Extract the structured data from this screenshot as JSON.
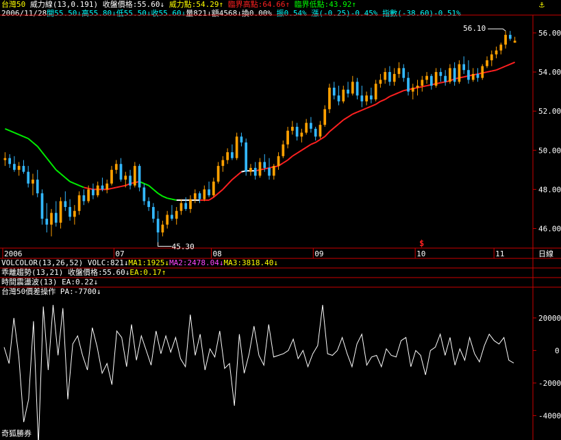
{
  "header": {
    "name": "台灣50",
    "ind_label": "威力線(13,0.191)",
    "close_label": "收盤價格:55.60↓",
    "power_label": "威力點:54.29↑",
    "critical_high": "臨界高點:64.66↑",
    "critical_low": "臨界低點:43.92↑"
  },
  "quote": {
    "date": "2006/11/28",
    "open": "開55.50↓",
    "high": "高55.80↓",
    "low": "低55.50↓",
    "close": "收55.60↓",
    "vol": "量821↓",
    "amount": "額4568↓",
    "turnover": "換0.00%",
    "amplitude": "振0.54%",
    "change": "漲(-0.25)-0.45%",
    "index": "指數(-38.60)-0.51%"
  },
  "panel1": {
    "vc_label": "VOLCOLOR(13,26,52)",
    "volc": "VOLC:821↓",
    "ma1": "MA1:1925↓",
    "ma2": "MA2:2478.04↓",
    "ma3": "MA3:3818.40↓"
  },
  "panel2": {
    "label": "乖離趨勢(13,21)",
    "close": "收盤價格:55.60↓",
    "ea": "EA:0.17↑"
  },
  "panel3": {
    "label": "時間震盪波(13)",
    "ea": "EA:0.22↓"
  },
  "panel4": {
    "label": "台灣50價差操作",
    "pa": "PA:-7700↓"
  },
  "footer": {
    "broker": "奇狐勝券"
  },
  "icons": {
    "anchor": "anchor-icon",
    "signal": "signal-s-icon"
  },
  "chart_data": [
    {
      "type": "candlestick",
      "ylim": [
        45,
        56.7
      ],
      "y_ticks": [
        "56.00",
        "54.00",
        "52.00",
        "50.00",
        "48.00",
        "46.00"
      ],
      "x_ticks": [
        "2006",
        "07",
        "08",
        "09",
        "10",
        "11"
      ],
      "period_label": "日線",
      "annotations": [
        "56.10",
        "45.30"
      ],
      "colors": {
        "up": "#ffa000",
        "down": "#33b8ff",
        "line_up": "#ff2020",
        "line_down": "#00ee00",
        "equal": "#ffffff"
      },
      "candles": [
        [
          49.5,
          49.9,
          49.2,
          49.6
        ],
        [
          49.6,
          49.8,
          49.1,
          49.3
        ],
        [
          49.3,
          49.7,
          48.9,
          49.0
        ],
        [
          49.0,
          49.4,
          48.7,
          49.2
        ],
        [
          49.2,
          49.5,
          48.8,
          48.9
        ],
        [
          48.9,
          49.2,
          48.1,
          48.3
        ],
        [
          48.3,
          48.8,
          47.7,
          48.5
        ],
        [
          48.5,
          49.0,
          47.6,
          47.8
        ],
        [
          47.8,
          48.0,
          46.2,
          46.5
        ],
        [
          46.5,
          47.3,
          45.8,
          46.2
        ],
        [
          46.2,
          47.0,
          45.6,
          46.8
        ],
        [
          46.8,
          47.4,
          46.1,
          46.3
        ],
        [
          46.3,
          47.6,
          46.0,
          47.4
        ],
        [
          47.4,
          47.9,
          46.9,
          47.1
        ],
        [
          47.1,
          47.5,
          46.4,
          46.6
        ],
        [
          46.6,
          47.2,
          46.2,
          46.9
        ],
        [
          46.9,
          47.9,
          46.7,
          47.7
        ],
        [
          47.7,
          48.0,
          47.2,
          47.4
        ],
        [
          47.4,
          48.2,
          47.3,
          48.0
        ],
        [
          48.0,
          48.3,
          47.5,
          47.7
        ],
        [
          47.7,
          48.4,
          47.6,
          48.2
        ],
        [
          48.2,
          48.6,
          47.9,
          48.0
        ],
        [
          48.0,
          48.5,
          47.8,
          48.3
        ],
        [
          48.3,
          49.2,
          48.2,
          49.0
        ],
        [
          49.0,
          49.5,
          48.8,
          49.3
        ],
        [
          49.3,
          49.6,
          48.4,
          48.5
        ],
        [
          48.5,
          48.9,
          48.1,
          48.7
        ],
        [
          48.7,
          49.0,
          48.0,
          48.2
        ],
        [
          48.2,
          49.4,
          48.1,
          49.2
        ],
        [
          49.2,
          49.3,
          47.9,
          48.1
        ],
        [
          48.1,
          48.3,
          47.2,
          47.4
        ],
        [
          47.4,
          47.6,
          46.9,
          47.1
        ],
        [
          47.1,
          47.3,
          46.3,
          46.5
        ],
        [
          46.5,
          46.9,
          45.3,
          45.8
        ],
        [
          45.8,
          46.4,
          45.6,
          46.2
        ],
        [
          46.2,
          46.9,
          46.0,
          46.7
        ],
        [
          46.7,
          47.2,
          46.4,
          46.5
        ],
        [
          46.5,
          47.1,
          46.2,
          46.9
        ],
        [
          46.9,
          47.5,
          46.7,
          47.3
        ],
        [
          47.3,
          47.6,
          46.9,
          47.0
        ],
        [
          47.0,
          47.7,
          46.8,
          47.5
        ],
        [
          47.5,
          48.0,
          47.3,
          47.8
        ],
        [
          47.8,
          47.9,
          47.3,
          47.5
        ],
        [
          47.5,
          48.2,
          47.4,
          48.0
        ],
        [
          48.0,
          48.4,
          47.6,
          47.7
        ],
        [
          47.7,
          48.6,
          47.6,
          48.4
        ],
        [
          48.4,
          49.4,
          48.3,
          49.2
        ],
        [
          49.2,
          49.7,
          48.9,
          49.5
        ],
        [
          49.5,
          50.1,
          49.3,
          49.9
        ],
        [
          49.9,
          50.3,
          49.5,
          49.6
        ],
        [
          49.6,
          50.9,
          49.5,
          50.7
        ],
        [
          50.7,
          50.9,
          50.2,
          50.4
        ],
        [
          50.4,
          50.6,
          48.7,
          48.9
        ],
        [
          48.9,
          49.3,
          48.7,
          49.1
        ],
        [
          49.1,
          49.4,
          48.5,
          48.7
        ],
        [
          48.7,
          49.6,
          48.6,
          49.4
        ],
        [
          49.4,
          49.8,
          48.9,
          49.1
        ],
        [
          49.1,
          49.6,
          48.5,
          48.7
        ],
        [
          48.7,
          49.3,
          48.5,
          49.2
        ],
        [
          49.2,
          49.9,
          49.0,
          49.7
        ],
        [
          49.7,
          50.5,
          49.6,
          50.3
        ],
        [
          50.3,
          51.2,
          50.1,
          51.0
        ],
        [
          51.0,
          51.5,
          50.8,
          51.2
        ],
        [
          51.2,
          51.4,
          50.5,
          50.7
        ],
        [
          50.7,
          51.1,
          50.4,
          50.9
        ],
        [
          50.9,
          51.6,
          50.8,
          51.4
        ],
        [
          51.4,
          51.7,
          50.9,
          51.1
        ],
        [
          51.1,
          51.2,
          50.5,
          50.7
        ],
        [
          50.7,
          51.5,
          50.6,
          51.3
        ],
        [
          51.3,
          52.3,
          51.2,
          52.1
        ],
        [
          52.1,
          53.4,
          51.9,
          53.2
        ],
        [
          53.2,
          53.5,
          52.6,
          52.8
        ],
        [
          52.8,
          53.3,
          52.3,
          52.5
        ],
        [
          52.5,
          53.3,
          52.4,
          53.1
        ],
        [
          53.1,
          53.5,
          52.7,
          52.9
        ],
        [
          52.9,
          53.8,
          52.8,
          53.5
        ],
        [
          53.5,
          53.7,
          52.6,
          52.8
        ],
        [
          52.8,
          53.3,
          52.2,
          52.5
        ],
        [
          52.5,
          53.0,
          52.3,
          52.8
        ],
        [
          52.8,
          53.2,
          52.4,
          52.6
        ],
        [
          52.6,
          53.6,
          52.5,
          53.4
        ],
        [
          53.4,
          53.9,
          53.2,
          53.6
        ],
        [
          53.6,
          54.2,
          53.4,
          54.0
        ],
        [
          54.0,
          54.3,
          53.3,
          53.5
        ],
        [
          53.5,
          54.2,
          53.3,
          53.9
        ],
        [
          53.9,
          54.5,
          53.7,
          54.2
        ],
        [
          54.2,
          54.4,
          53.5,
          53.7
        ],
        [
          53.7,
          54.0,
          52.8,
          53.0
        ],
        [
          53.0,
          53.4,
          52.6,
          53.2
        ],
        [
          53.2,
          53.6,
          52.8,
          53.3
        ],
        [
          53.3,
          53.8,
          53.0,
          53.6
        ],
        [
          53.6,
          54.0,
          53.4,
          53.8
        ],
        [
          53.8,
          53.9,
          53.1,
          53.3
        ],
        [
          53.3,
          54.2,
          53.2,
          54.0
        ],
        [
          54.0,
          54.2,
          53.5,
          53.8
        ],
        [
          53.8,
          54.1,
          53.3,
          53.5
        ],
        [
          53.5,
          54.4,
          53.4,
          54.2
        ],
        [
          54.2,
          54.5,
          53.3,
          53.5
        ],
        [
          53.5,
          54.6,
          53.4,
          54.4
        ],
        [
          54.4,
          54.8,
          53.9,
          54.1
        ],
        [
          54.1,
          54.6,
          53.4,
          53.6
        ],
        [
          53.6,
          54.2,
          53.5,
          53.9
        ],
        [
          53.9,
          54.2,
          53.5,
          53.7
        ],
        [
          53.7,
          54.4,
          53.6,
          54.3
        ],
        [
          54.3,
          54.8,
          54.2,
          54.6
        ],
        [
          54.6,
          55.1,
          54.3,
          54.9
        ],
        [
          54.9,
          55.3,
          54.7,
          55.1
        ],
        [
          55.1,
          55.5,
          54.9,
          55.4
        ],
        [
          55.4,
          56.1,
          55.2,
          55.9
        ],
        [
          55.9,
          56.1,
          55.6,
          55.7
        ],
        [
          55.5,
          55.8,
          55.5,
          55.6
        ]
      ],
      "line": [
        51.1,
        51.0,
        50.9,
        50.8,
        50.7,
        50.6,
        50.4,
        50.2,
        49.9,
        49.6,
        49.3,
        49.0,
        48.8,
        48.6,
        48.4,
        48.3,
        48.2,
        48.1,
        48.05,
        48.0,
        48.0,
        48.0,
        48.0,
        48.05,
        48.1,
        48.15,
        48.2,
        48.3,
        48.35,
        48.4,
        48.3,
        48.2,
        48.0,
        47.8,
        47.65,
        47.55,
        47.5,
        47.45,
        47.45,
        47.45,
        47.45,
        47.45,
        47.45,
        47.45,
        47.45,
        47.6,
        47.8,
        48.0,
        48.25,
        48.5,
        48.7,
        48.9,
        48.95,
        48.95,
        48.95,
        49.0,
        49.05,
        49.1,
        49.15,
        49.2,
        49.35,
        49.5,
        49.7,
        49.85,
        50.0,
        50.15,
        50.3,
        50.4,
        50.55,
        50.7,
        50.95,
        51.15,
        51.35,
        51.55,
        51.7,
        51.85,
        51.95,
        52.05,
        52.15,
        52.25,
        52.35,
        52.5,
        52.6,
        52.75,
        52.85,
        52.95,
        53.05,
        53.1,
        53.15,
        53.2,
        53.25,
        53.3,
        53.35,
        53.4,
        53.45,
        53.5,
        53.55,
        53.65,
        53.7,
        53.75,
        53.8,
        53.85,
        53.9,
        53.95,
        54.0,
        54.05,
        54.1,
        54.2,
        54.3,
        54.4,
        54.5
      ],
      "line_trend": [
        "d",
        "d",
        "d",
        "d",
        "d",
        "d",
        "d",
        "d",
        "d",
        "d",
        "d",
        "d",
        "d",
        "d",
        "d",
        "d",
        "d",
        "u",
        "u",
        "u",
        "u",
        "u",
        "u",
        "u",
        "u",
        "u",
        "u",
        "u",
        "u",
        "d",
        "d",
        "d",
        "d",
        "d",
        "d",
        "d",
        "d",
        "e",
        "e",
        "e",
        "e",
        "e",
        "u",
        "u",
        "u",
        "u",
        "u",
        "u",
        "u",
        "u",
        "u",
        "e",
        "e",
        "e",
        "u",
        "u",
        "u",
        "u",
        "u",
        "u",
        "u",
        "u",
        "u",
        "u",
        "u",
        "u",
        "u",
        "u",
        "u",
        "u",
        "u",
        "u",
        "u",
        "u",
        "u",
        "u",
        "u",
        "u",
        "u",
        "u",
        "u",
        "u",
        "u",
        "u",
        "u",
        "u",
        "u",
        "u",
        "u",
        "u",
        "u",
        "u",
        "u",
        "u",
        "u",
        "u",
        "u",
        "u",
        "u",
        "u",
        "u",
        "u",
        "u",
        "u",
        "u",
        "u",
        "u",
        "u",
        "u",
        "u",
        "u"
      ]
    },
    {
      "type": "line",
      "title": "台灣50價差操作",
      "ylim": [
        -55000,
        33000
      ],
      "y_ticks": [
        20000,
        0,
        -20000,
        -40000
      ],
      "values": [
        2000,
        -8000,
        20000,
        -4000,
        -44000,
        -30000,
        18000,
        -58000,
        27000,
        -12000,
        28000,
        -3000,
        26000,
        -30000,
        4000,
        9000,
        -3000,
        -12000,
        14000,
        2000,
        -14000,
        -8000,
        -21000,
        12000,
        8000,
        -10000,
        16000,
        -6000,
        9000,
        0,
        -9000,
        12000,
        -2000,
        9000,
        -1000,
        8000,
        -5000,
        -10000,
        22000,
        -3000,
        10000,
        -12000,
        1000,
        -4000,
        12000,
        -11000,
        -8000,
        -34000,
        10000,
        -14000,
        -2000,
        15000,
        -3000,
        -9000,
        16000,
        -4000,
        -3000,
        -2000,
        0,
        7000,
        -5000,
        0,
        -10000,
        -2000,
        3000,
        28000,
        -2000,
        -3000,
        0,
        8000,
        -2000,
        -10000,
        4000,
        10000,
        -9000,
        -4000,
        -3000,
        -10000,
        1000,
        -3000,
        -4000,
        6000,
        8000,
        -10000,
        0,
        -3000,
        -15000,
        0,
        2000,
        10000,
        -3000,
        8000,
        -9000,
        1000,
        -6000,
        8000,
        -2000,
        -7000,
        3000,
        10000,
        6000,
        4000,
        8000,
        -6000,
        -7700
      ]
    }
  ]
}
